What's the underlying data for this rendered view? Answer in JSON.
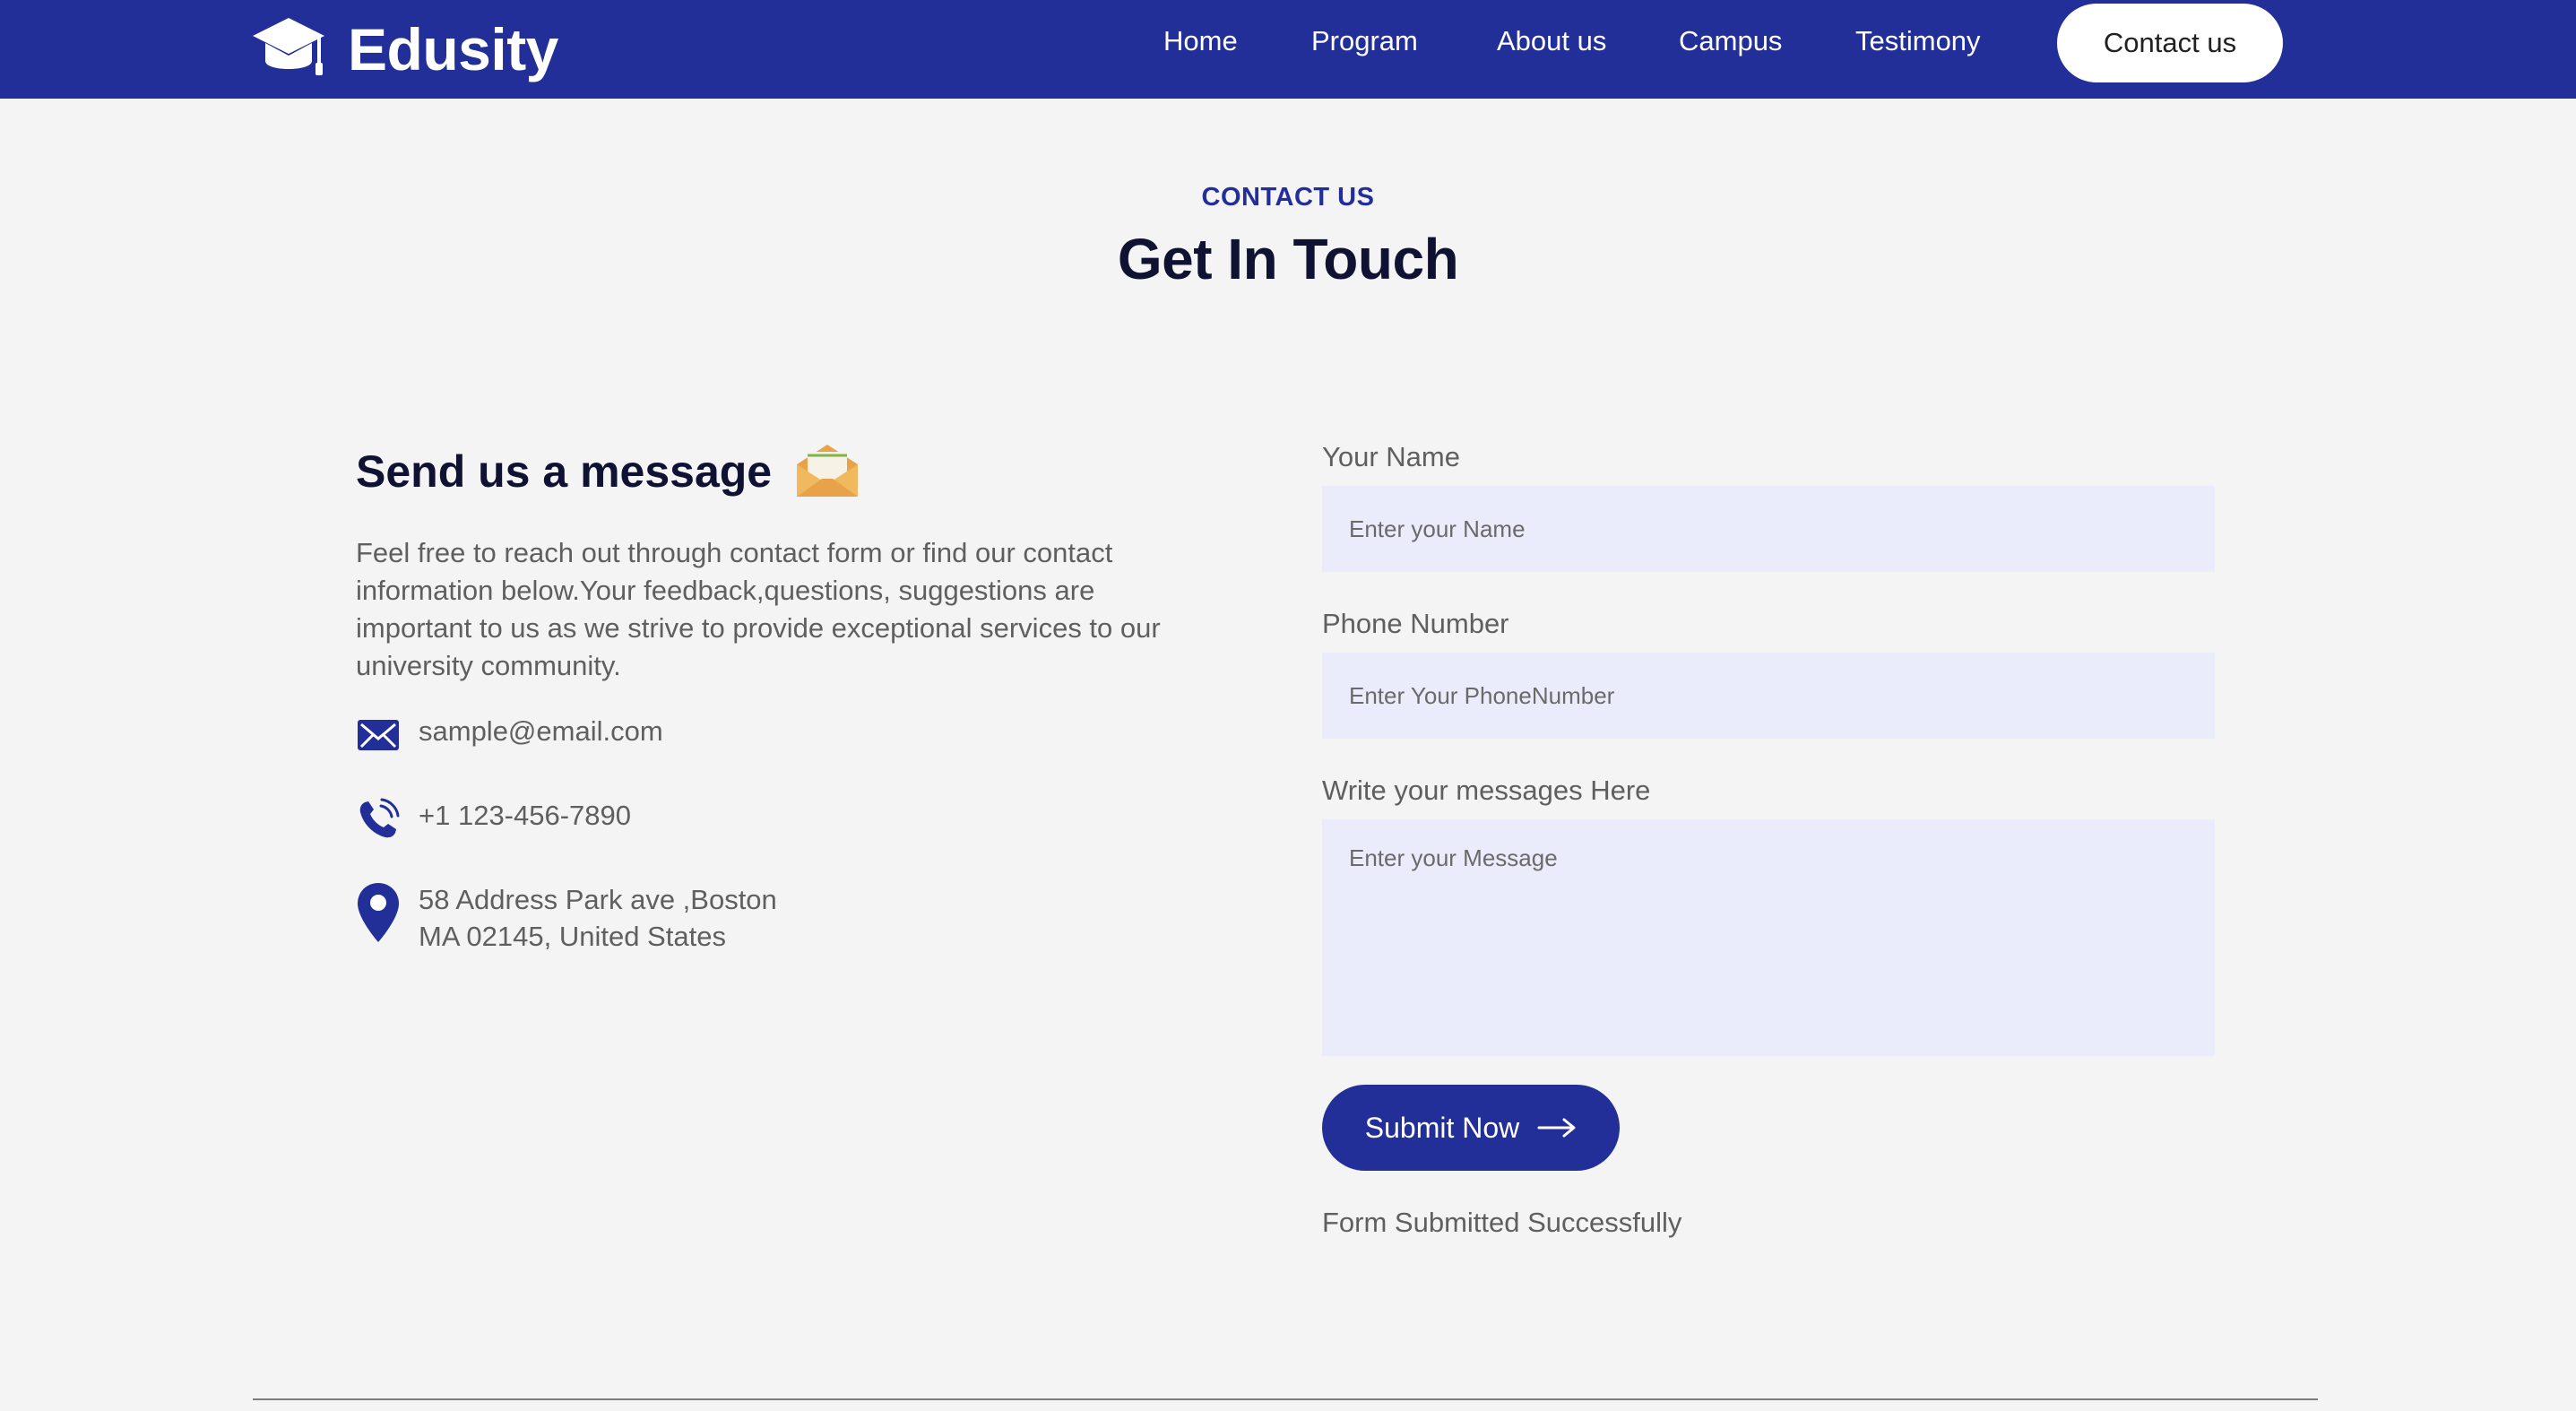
{
  "brand": {
    "name": "Edusity",
    "primary_color": "#232f98",
    "background_color": "#f4f4f4",
    "input_background": "#ebecfb"
  },
  "nav": {
    "items": [
      {
        "label": "Home"
      },
      {
        "label": "Program"
      },
      {
        "label": "About us"
      },
      {
        "label": "Campus"
      },
      {
        "label": "Testimony"
      }
    ],
    "cta_label": "Contact us"
  },
  "section": {
    "subtitle": "CONTACT US",
    "title": "Get In Touch"
  },
  "left": {
    "heading": "Send us a message",
    "heading_icon": "envelope-open-icon",
    "intro": "Feel free to reach out through contact form or find our contact information below.Your feedback,questions, suggestions are important to us as we strive to provide exceptional services to our university community.",
    "contacts": [
      {
        "icon": "mail-icon",
        "text": "sample@email.com"
      },
      {
        "icon": "phone-icon",
        "text": "+1 123-456-7890"
      },
      {
        "icon": "location-pin-icon",
        "text": "58 Address Park ave ,Boston\nMA 02145, United States"
      }
    ]
  },
  "form": {
    "name_label": "Your Name",
    "name_placeholder": "Enter your Name",
    "phone_label": "Phone Number",
    "phone_placeholder": "Enter Your PhoneNumber",
    "message_label": "Write your messages Here",
    "message_placeholder": "Enter your Message",
    "submit_label": "Submit Now",
    "submit_icon": "arrow-right-icon",
    "status_text": "Form Submitted Successfully"
  }
}
